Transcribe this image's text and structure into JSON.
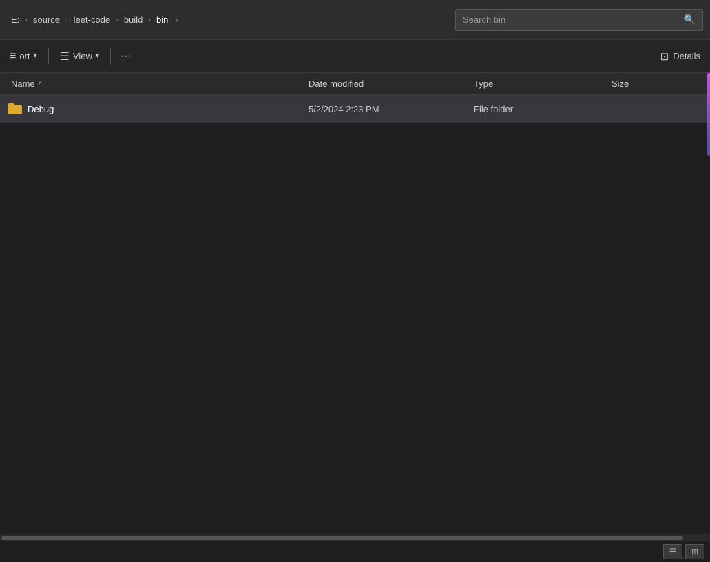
{
  "breadcrumb": {
    "items": [
      {
        "label": "E:",
        "id": "drive"
      },
      {
        "label": "source",
        "id": "source"
      },
      {
        "label": "leet-code",
        "id": "leet-code"
      },
      {
        "label": "build",
        "id": "build"
      },
      {
        "label": "bin",
        "id": "bin"
      }
    ],
    "expand_arrow": "›"
  },
  "search": {
    "placeholder": "Search bin"
  },
  "toolbar": {
    "sort_label": "ort",
    "sort_arrow": "▾",
    "view_label": "View",
    "view_arrow": "▾",
    "more_label": "···",
    "details_label": "Details"
  },
  "columns": {
    "name": "Name",
    "date_modified": "Date modified",
    "type": "Type",
    "size": "Size",
    "sort_arrow": "∧"
  },
  "files": [
    {
      "name": "Debug",
      "icon": "folder",
      "date_modified": "5/2/2024 2:23 PM",
      "type": "File folder",
      "size": ""
    }
  ],
  "status_bar": {
    "list_icon": "☰",
    "grid_icon": "⊞"
  }
}
